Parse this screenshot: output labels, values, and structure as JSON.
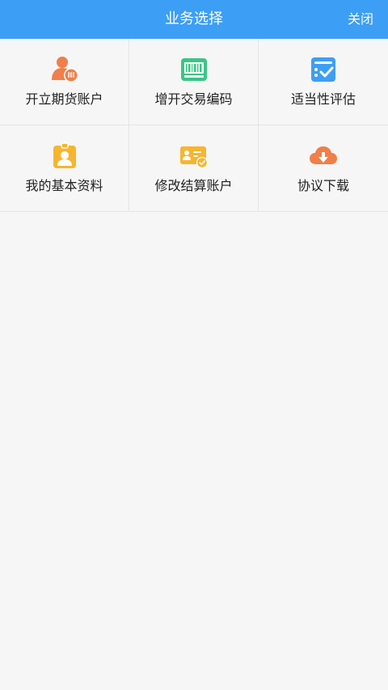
{
  "header": {
    "title": "业务选择",
    "close_label": "关闭",
    "bg_color": "#3d9ef5"
  },
  "menu": {
    "items": [
      {
        "label": "开立期货账户",
        "icon": "user-account-icon"
      },
      {
        "label": "增开交易编码",
        "icon": "barcode-icon"
      },
      {
        "label": "适当性评估",
        "icon": "checklist-icon"
      },
      {
        "label": "我的基本资料",
        "icon": "id-badge-icon"
      },
      {
        "label": "修改结算账户",
        "icon": "id-card-check-icon"
      },
      {
        "label": "协议下载",
        "icon": "cloud-download-icon"
      }
    ]
  }
}
